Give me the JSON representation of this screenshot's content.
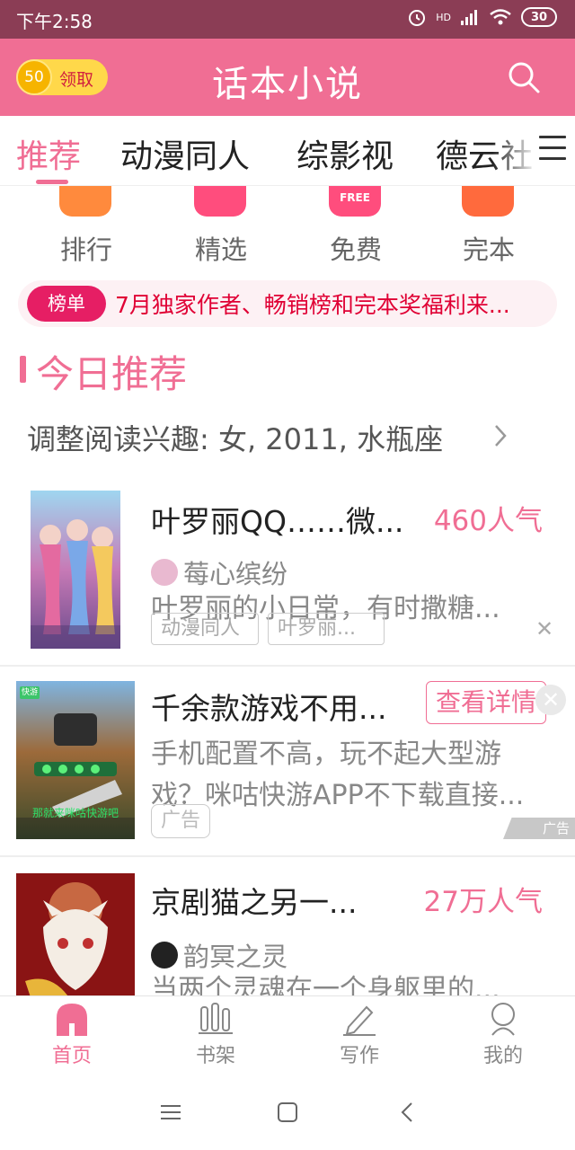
{
  "status_bar": {
    "time": "下午2:58",
    "network": "HD",
    "battery": "30"
  },
  "header": {
    "coin_value": "50",
    "coin_label": "领取",
    "title": "话本小说"
  },
  "tabs": [
    {
      "label": "推荐",
      "active": true
    },
    {
      "label": "动漫同人"
    },
    {
      "label": "综影视"
    },
    {
      "label": "德云社"
    }
  ],
  "categories": [
    {
      "label": "排行",
      "color": "#ff8a3d"
    },
    {
      "label": "精选",
      "color": "#ff4d7d"
    },
    {
      "label": "免费",
      "color": "#ff4d7d",
      "badge": "FREE"
    },
    {
      "label": "完本",
      "color": "#ff6a3d"
    }
  ],
  "banner": {
    "tag": "榜单",
    "text": "7月独家作者、畅销榜和完本奖福利来..."
  },
  "section": {
    "title": "今日推荐",
    "interest": "调整阅读兴趣: 女, 2011, 水瓶座"
  },
  "books": [
    {
      "title": "叶罗丽QQ……微...",
      "popularity": "460人气",
      "author": "莓心缤纷",
      "description": "叶罗丽的小日常，有时撒糖...",
      "tags": [
        "动漫同人",
        "叶罗丽..."
      ]
    },
    {
      "title": "京剧猫之另一...",
      "popularity": "27万人气",
      "author": "韵冥之灵",
      "description": "当两个灵魂在一个身躯里的..."
    }
  ],
  "ad": {
    "title": "千余款游戏不用...",
    "detail_button": "查看详情",
    "description_line1": "手机配置不高，玩不起大型游",
    "description_line2": "戏？咪咕快游APP不下载直接...",
    "badge": "广告",
    "corner_label": "广告",
    "image_logo": "快游",
    "image_caption": "那就来咪咕快游吧"
  },
  "bottom_nav": [
    {
      "label": "首页",
      "active": true
    },
    {
      "label": "书架"
    },
    {
      "label": "写作"
    },
    {
      "label": "我的"
    }
  ],
  "colors": {
    "accent": "#f06e94",
    "status_bar": "#8b3d55",
    "banner_red": "#e00034"
  }
}
